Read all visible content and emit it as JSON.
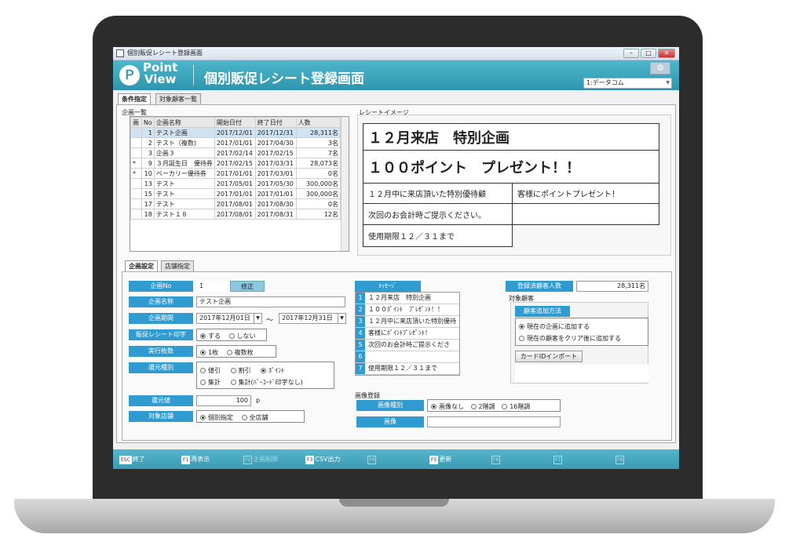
{
  "window": {
    "title": "個別販促レシート登録画面",
    "min": "–",
    "max": "□",
    "close": "✕"
  },
  "header": {
    "logo_line1": "Point",
    "logo_line2": "View",
    "title": "個別販促レシート登録画面",
    "db_select": "1:データコム"
  },
  "top_tabs": [
    {
      "label": "条件指定"
    },
    {
      "label": "対象顧客一覧"
    }
  ],
  "plan_list": {
    "label": "企画一覧",
    "columns": [
      "画",
      "No",
      "企画名称",
      "開始日付",
      "終了日付",
      "人数"
    ],
    "rows": [
      {
        "mark": "",
        "no": "1",
        "name": "テスト企画",
        "start": "2017/12/01",
        "end": "2017/12/31",
        "count": "28,311名"
      },
      {
        "mark": "",
        "no": "2",
        "name": "テスト（複数)",
        "start": "2017/01/01",
        "end": "2017/04/30",
        "count": "3名"
      },
      {
        "mark": "",
        "no": "3",
        "name": "企画３",
        "start": "2017/02/14",
        "end": "2017/02/15",
        "count": "7名"
      },
      {
        "mark": "*",
        "no": "9",
        "name": "３月誕生日　優待券",
        "start": "2017/02/15",
        "end": "2017/03/31",
        "count": "28,073名"
      },
      {
        "mark": "*",
        "no": "10",
        "name": "ベーカリー優待券",
        "start": "2017/01/01",
        "end": "2017/03/01",
        "count": "0名"
      },
      {
        "mark": "",
        "no": "13",
        "name": "テスト",
        "start": "2017/05/01",
        "end": "2017/05/30",
        "count": "300,000名"
      },
      {
        "mark": "",
        "no": "15",
        "name": "テスト",
        "start": "2017/01/01",
        "end": "2017/01/01",
        "count": "300,000名"
      },
      {
        "mark": "",
        "no": "17",
        "name": "テスト",
        "start": "2017/08/01",
        "end": "2017/08/30",
        "count": "0名"
      },
      {
        "mark": "",
        "no": "18",
        "name": "テスト１８",
        "start": "2017/08/01",
        "end": "2017/08/31",
        "count": "12名"
      }
    ]
  },
  "receipt": {
    "label": "レシートイメージ",
    "line1": "１２月来店　特別企画",
    "line2": "１００ポイント　プレゼント！！",
    "line3a": "１２月中に来店頂いた特別優待顧",
    "line3b": "客様にポイントプレゼント！",
    "line4": "次回のお会計時ご提示ください。",
    "line5": "使用期限１２／３１まで"
  },
  "sub_tabs": [
    {
      "label": "企画設定"
    },
    {
      "label": "店舗指定"
    }
  ],
  "form": {
    "plan_no_label": "企画No",
    "plan_no": "1",
    "edit_button": "修正",
    "plan_name_label": "企画名称",
    "plan_name": "テスト企画",
    "period_label": "企画期間",
    "period_start": "2017年12月01日",
    "period_sep": "～",
    "period_end": "2017年12月31日",
    "print_label": "販促レシート印字",
    "print_yes": "する",
    "print_no": "しない",
    "copies_label": "実行枚数",
    "copies_one": "1枚",
    "copies_multi": "複数枚",
    "return_type_label": "還元種別",
    "rt1": "値引",
    "rt2": "割引",
    "rt3": "ﾎﾟｲﾝﾄ",
    "rt4": "集計",
    "rt5": "集計(ﾊﾞｰｺｰﾄﾞ印字なし)",
    "return_value_label": "還元値",
    "return_value": "100",
    "return_unit": "p",
    "store_label": "対象店舗",
    "store_individual": "個別指定",
    "store_all": "全店舗"
  },
  "message": {
    "label": "ﾒｯｾｰｼﾞ",
    "lines": [
      {
        "n": "1",
        "text": "１２月来店　特別企画"
      },
      {
        "n": "2",
        "text": "１００ﾎﾟｲﾝﾄ　ﾌﾟﾚｾﾞﾝﾄ！！"
      },
      {
        "n": "3",
        "text": "１２月中に来店頂いた特別優待顧"
      },
      {
        "n": "4",
        "text": "客様にﾎﾟｲﾝﾄﾌﾟﾚｾﾞﾝﾄ！"
      },
      {
        "n": "5",
        "text": "次回のお会計時ご提示ください。"
      },
      {
        "n": "6",
        "text": ""
      },
      {
        "n": "7",
        "text": "使用期限１２／３１まで"
      }
    ]
  },
  "customers": {
    "registered_label": "登録済顧客人数",
    "registered_count": "28,311名",
    "target_label": "対象顧客",
    "add_method_label": "顧客追加方法",
    "opt1": "現在の企画に追加する",
    "opt2": "現在の顧客をクリア後に追加する",
    "import_button": "カードIDインポート"
  },
  "image": {
    "section_label": "画像登録",
    "type_label": "画像種別",
    "type_none": "画像なし",
    "type_2": "2階調",
    "type_16": "16階調",
    "image_label": "画像"
  },
  "fkeys": [
    {
      "key": "ESC",
      "label": "終了",
      "enabled": true
    },
    {
      "key": "F1",
      "label": "再表示",
      "enabled": true
    },
    {
      "key": "F2",
      "label": "企画削除",
      "enabled": false
    },
    {
      "key": "F3",
      "label": "CSV出力",
      "enabled": true
    },
    {
      "key": "F4",
      "label": "",
      "enabled": false
    },
    {
      "key": "F5",
      "label": "更新",
      "enabled": true
    },
    {
      "key": "F6",
      "label": "",
      "enabled": false
    },
    {
      "key": "F7",
      "label": "",
      "enabled": false
    },
    {
      "key": "F8",
      "label": "",
      "enabled": false
    }
  ],
  "colors": {
    "accent": "#2f9bd0",
    "header": "#3aa6bd",
    "selected_row": "#cfe3f3"
  }
}
